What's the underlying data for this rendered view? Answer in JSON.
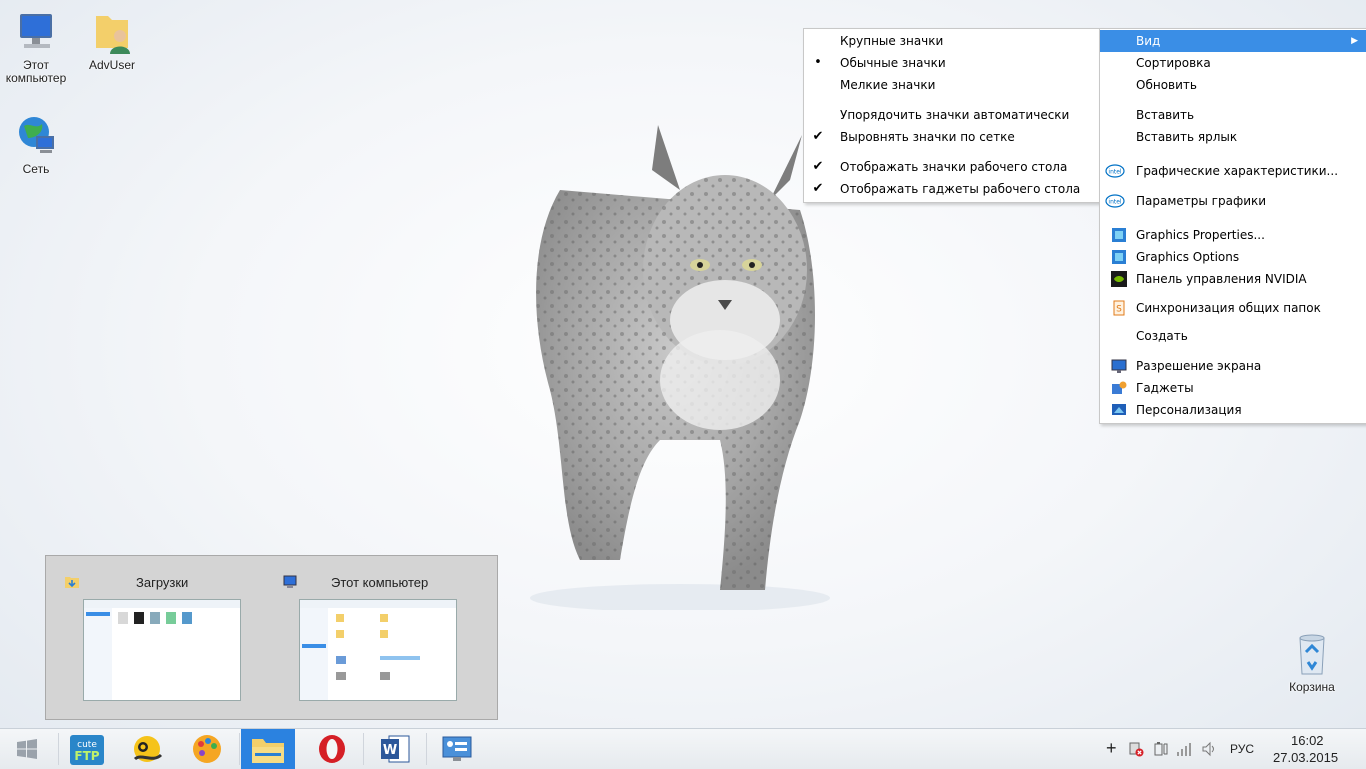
{
  "desktop": {
    "icons": [
      {
        "label": "Этот\nкомпьютер"
      },
      {
        "label": "AdvUser"
      },
      {
        "label": "Сеть"
      },
      {
        "label": "Корзина"
      }
    ]
  },
  "view_submenu": {
    "items": [
      {
        "label": "Крупные значки",
        "mark": ""
      },
      {
        "label": "Обычные значки",
        "mark": "•"
      },
      {
        "label": "Мелкие значки",
        "mark": ""
      },
      {
        "label": "Упорядочить значки автоматически",
        "mark": ""
      },
      {
        "label": "Выровнять значки по сетке",
        "mark": "✔"
      },
      {
        "label": "Отображать значки рабочего стола",
        "mark": "✔"
      },
      {
        "label": "Отображать гаджеты  рабочего стола",
        "mark": "✔"
      }
    ]
  },
  "context_menu": {
    "items": [
      {
        "label": "Вид",
        "icon": ""
      },
      {
        "label": "Сортировка",
        "icon": ""
      },
      {
        "label": "Обновить",
        "icon": ""
      },
      {
        "label": "Вставить",
        "icon": ""
      },
      {
        "label": "Вставить ярлык",
        "icon": ""
      },
      {
        "label": "Графические характеристики...",
        "icon": "intel-icon"
      },
      {
        "label": "Параметры графики",
        "icon": "intel-icon"
      },
      {
        "label": "Graphics Properties...",
        "icon": "graphics-icon"
      },
      {
        "label": "Graphics Options",
        "icon": "graphics-icon"
      },
      {
        "label": "Панель управления NVIDIA",
        "icon": "nvidia-icon"
      },
      {
        "label": "Синхронизация общих папок",
        "icon": "sync-icon"
      },
      {
        "label": "Создать",
        "icon": ""
      },
      {
        "label": "Разрешение экрана",
        "icon": "monitor-icon"
      },
      {
        "label": "Гаджеты",
        "icon": "gadgets-icon"
      },
      {
        "label": "Персонализация",
        "icon": "personalize-icon"
      }
    ],
    "arrow": "▶"
  },
  "preview": {
    "windows": [
      {
        "title": "Загрузки"
      },
      {
        "title": "Этот компьютер"
      }
    ]
  },
  "taskbar": {
    "tray": {
      "plus": "+",
      "language": "РУС",
      "time": "16:02",
      "date": "27.03.2015"
    }
  },
  "colors": {
    "menu_highlight": "#3a8ee6",
    "taskbar_active": "#2b82e0"
  }
}
